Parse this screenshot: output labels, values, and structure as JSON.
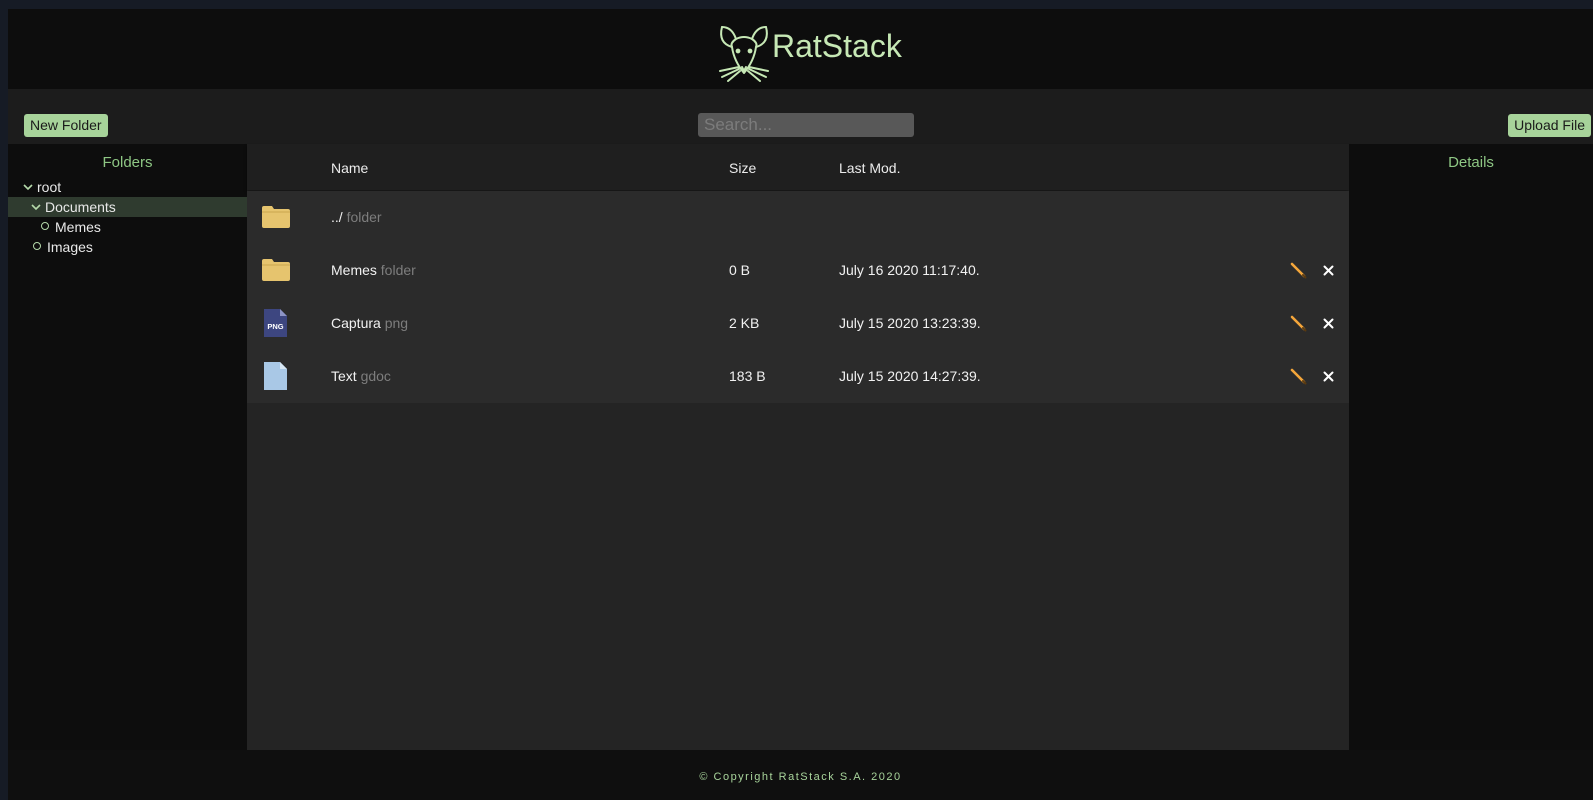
{
  "app": {
    "brand": "RatStack"
  },
  "toolbar": {
    "new_folder_label": "New Folder",
    "search_placeholder": "Search...",
    "search_value": "",
    "upload_label": "Upload File"
  },
  "sidebar": {
    "title": "Folders",
    "tree": [
      {
        "label": "root",
        "expanded": true,
        "selected": false
      },
      {
        "label": "Documents",
        "expanded": true,
        "selected": true
      },
      {
        "label": "Memes",
        "expanded": false,
        "selected": false
      },
      {
        "label": "Images",
        "expanded": false,
        "selected": false
      }
    ]
  },
  "table": {
    "headers": {
      "name": "Name",
      "size": "Size",
      "modified": "Last Mod."
    },
    "rows": [
      {
        "name": "../",
        "type": "folder",
        "size": "",
        "modified": "",
        "icon": "folder-icon"
      },
      {
        "name": "Memes",
        "type": "folder",
        "size": "0 B",
        "modified": "July 16 2020 11:17:40.",
        "icon": "folder-icon"
      },
      {
        "name": "Captura",
        "type": "png",
        "size": "2 KB",
        "modified": "July 15 2020 13:23:39.",
        "icon": "png-file-icon"
      },
      {
        "name": "Text",
        "type": "gdoc",
        "size": "183 B",
        "modified": "July 15 2020 14:27:39.",
        "icon": "document-file-icon"
      }
    ]
  },
  "details": {
    "title": "Details"
  },
  "footer": {
    "copyright": "© Copyright RatStack S.A. 2020"
  },
  "colors": {
    "accent": "#a7d39a",
    "accent_text": "#8ec784",
    "header_bg": "#0d0d0d",
    "main_bg": "#242424",
    "folder": "#e6c46e",
    "png_icon": "#3d4680",
    "doc_icon": "#a9c8e6",
    "edit_icon": "#f4a63a"
  }
}
